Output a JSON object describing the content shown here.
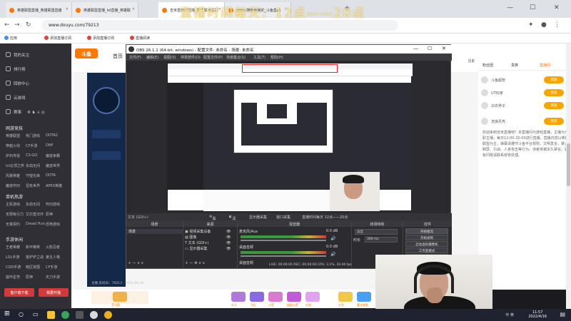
{
  "browser": {
    "tabs": [
      {
        "label": "英雄联盟直播_英雄联盟直播"
      },
      {
        "label": "英雄联盟直播_lol直播_英雄联"
      },
      {
        "label": "吉米直播吧直播_英雄联盟视频"
      },
      {
        "label": "AoRu 随时听我的_斗鱼直播"
      }
    ],
    "overlay_title": "直播时间每天：12点——20点",
    "url": "www.douyu.com/79213",
    "bookmarks": [
      {
        "label": "应用",
        "color": "#4a8af4"
      },
      {
        "label": "添加直播订阅",
        "color": "#e04040"
      },
      {
        "label": "添加直播订阅",
        "color": "#e04040"
      },
      {
        "label": "直播阅读",
        "color": "#e04040"
      }
    ]
  },
  "douyu": {
    "logo": "斗鱼",
    "nav": [
      "首页",
      "直播",
      "分类",
      "视频",
      "游戏",
      "鱼吧"
    ],
    "nav_active": 1,
    "header_right": [
      "历史",
      "关注",
      "下载",
      "创作中心",
      "开播"
    ],
    "sidebar": {
      "top_items": [
        "我的关注",
        "排行榜",
        "回放中心",
        "云游戏"
      ],
      "row_icons": [
        "赛事"
      ],
      "sections": [
        {
          "title": "网游竞技",
          "items": [
            "英雄联盟",
            "热门游戏",
            "DOTA2",
            "穿越火线",
            "CF手游",
            "DNF",
            "炉石传说",
            "CS:GO",
            "魔兽争霸",
            "lol云顶之弈",
            "永劫无间",
            "魔兽世界",
            "风暴英雄",
            "守望先锋",
            "DOTA",
            "魔兽怀旧",
            "坦克世界",
            "APEX英雄"
          ]
        },
        {
          "title": "单机热游",
          "items": [
            "主机游戏",
            "永劫无间",
            "怀旧游戏",
            "无限吸引力",
            "艾尔登法环",
            "原神",
            "无畏契约",
            "Dread Hun...",
            "恐怖游戏"
          ]
        },
        {
          "title": "手游休闲",
          "items": [
            "王者荣耀",
            "和平精英",
            "火影忍者",
            "LOL手游",
            "金铲铲之战",
            "第五人格",
            "COD手游",
            "暗区突围",
            "CF手游",
            "崩坏星穹",
            "原神",
            "天刀手游"
          ]
        }
      ],
      "btn_live": "客户端下载",
      "btn_download": "我要开播"
    },
    "right_panel": {
      "tabs": [
        "粉丝团",
        "贵族",
        "直播间"
      ],
      "rows": [
        {
          "text": "斗鱼超管",
          "badge": "贵族"
        },
        {
          "text": "UT玩家",
          "badge": "贵族"
        },
        {
          "text": "白衣男子",
          "badge": "贵族"
        },
        {
          "text": "流浪月亮",
          "badge": "贵族"
        }
      ],
      "notice": "欢迎来到吉米直播吧！本直播间为游戏直播，主播为全职主播，每日12:00-20:00进行直播。直播内容以英雄联盟为主，弹幕请遵守斗鱼平台规则，文明发言，禁止刷屏、引战、人身攻击等行为，违者将被永久禁言。如有问题请联系房管处理。"
    },
    "player_info": "主播 房间ID：79213 · 2022.04.16",
    "gifts": [
      "荧光棒",
      "办卡",
      "飞机",
      "火箭",
      "超级火箭",
      "礼物",
      "太空",
      "魔法城堡"
    ]
  },
  "obs": {
    "title": "OBS 26.1.1 (64-bit, windows) - 配置文件: 未命名 - 场景: 未命名",
    "menu": [
      "文件(F)",
      "编辑(E)",
      "视图(V)",
      "停靠部件(D)",
      "配置文件(P)",
      "场景集合(S)",
      "工具(T)",
      "帮助(H)"
    ],
    "toolbar": [
      "属性",
      "滤镜",
      "图像",
      "显示器采集",
      "窗口采集",
      "直播时间每天 12点——20点"
    ],
    "docks": {
      "scenes": {
        "title": "场景",
        "items": [
          "场景"
        ]
      },
      "sources": {
        "title": "来源",
        "items": [
          "视频采集设备",
          "图像",
          "文本 (GDI+)",
          "显示器采集"
        ]
      },
      "mixer": {
        "title": "混音器",
        "tracks": [
          {
            "name": "麦克风/Aux",
            "db": "0.0 dB"
          },
          {
            "name": "桌面音频",
            "db": "0.0 dB"
          }
        ],
        "bottom": "桌面音频"
      },
      "transitions": {
        "title": "转场特效",
        "type": "淡出",
        "duration_label": "时长",
        "duration": "300 ms"
      },
      "controls": {
        "title": "控件",
        "buttons": [
          "开始推流",
          "开始录制",
          "启动虚拟摄像机",
          "工作室模式",
          "设置",
          "退出"
        ]
      }
    },
    "status": "LIVE: 00:00:00  REC: 00:00:00  CPU: 3.1%, 30.00 fps"
  },
  "taskbar": {
    "time": "11:57",
    "date": "2022/4/16",
    "tray": "中  英"
  }
}
